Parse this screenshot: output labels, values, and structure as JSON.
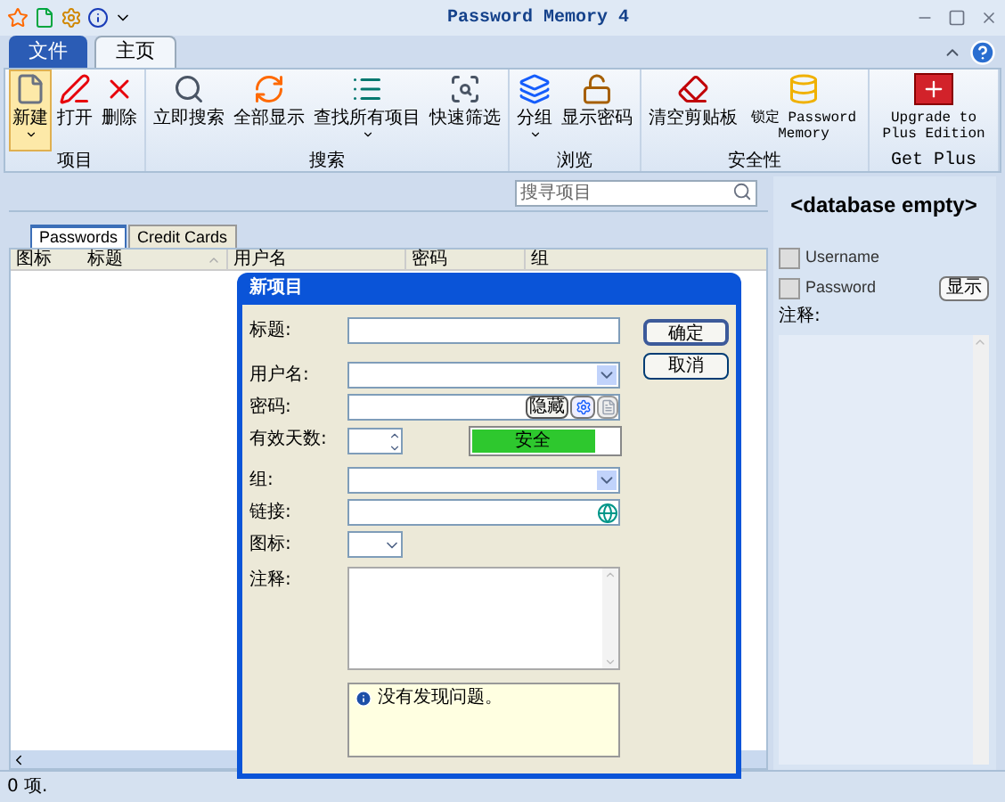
{
  "window": {
    "title": "Password Memory 4"
  },
  "ribbon": {
    "tabs": [
      {
        "label": "文件",
        "kind": "file",
        "selected": false
      },
      {
        "label": "主页",
        "kind": "tab",
        "selected": true
      }
    ],
    "groups": [
      {
        "label": "项目",
        "buttons": [
          {
            "label": "新建",
            "dropdown": true,
            "highlighted": true
          },
          {
            "label": "打开",
            "dropdown": false,
            "highlighted": false
          },
          {
            "label": "删除",
            "dropdown": false,
            "highlighted": false
          }
        ]
      },
      {
        "label": "搜索",
        "buttons": [
          {
            "label": "立即搜索",
            "dropdown": false,
            "highlighted": false
          },
          {
            "label": "全部显示",
            "dropdown": false,
            "highlighted": false
          },
          {
            "label": "查找所有项目",
            "dropdown": true,
            "highlighted": false
          },
          {
            "label": "快速筛选",
            "dropdown": false,
            "highlighted": false
          }
        ]
      },
      {
        "label": "浏览",
        "buttons": [
          {
            "label": "分组",
            "dropdown": true,
            "highlighted": false
          },
          {
            "label": "显示密码",
            "dropdown": false,
            "highlighted": false
          }
        ]
      },
      {
        "label": "安全性",
        "buttons": [
          {
            "label": "清空剪贴板",
            "dropdown": false,
            "highlighted": false
          },
          {
            "label": "锁定 Password Memory",
            "dropdown": false,
            "highlighted": false
          }
        ]
      },
      {
        "label": "Get Plus",
        "buttons": [
          {
            "label": "Upgrade to Plus Edition",
            "dropdown": false,
            "highlighted": false
          }
        ]
      }
    ]
  },
  "search": {
    "placeholder": "搜寻项目"
  },
  "list_tabs": [
    {
      "label": "Passwords",
      "selected": true
    },
    {
      "label": "Credit Cards",
      "selected": false
    }
  ],
  "columns": [
    {
      "label": "图标",
      "sorted": false
    },
    {
      "label": "标题",
      "sorted": true
    },
    {
      "label": "用户名",
      "sorted": false
    },
    {
      "label": "密码",
      "sorted": false
    },
    {
      "label": "组",
      "sorted": false
    }
  ],
  "details": {
    "heading": "<database empty>",
    "fields": [
      {
        "label": "Username"
      },
      {
        "label": "Password",
        "button": "显示"
      }
    ],
    "notes_label": "注释:"
  },
  "dialog": {
    "title": "新项目",
    "fields": [
      {
        "label": "标题:",
        "kind": "text"
      },
      {
        "label": "用户名:",
        "kind": "combo"
      },
      {
        "label": "密码:",
        "kind": "password",
        "hide_button": "隐藏"
      },
      {
        "label": "有效天数:",
        "kind": "spinner",
        "strength": {
          "label": "安全",
          "level": 0.82
        }
      },
      {
        "label": "组:",
        "kind": "combo"
      },
      {
        "label": "链接:",
        "kind": "link"
      },
      {
        "label": "图标:",
        "kind": "small_combo"
      },
      {
        "label": "注释:",
        "kind": "textarea"
      }
    ],
    "message": "没有发现问题。",
    "buttons": [
      "确定",
      "取消"
    ]
  },
  "status_bar": {
    "text": "0 项."
  }
}
